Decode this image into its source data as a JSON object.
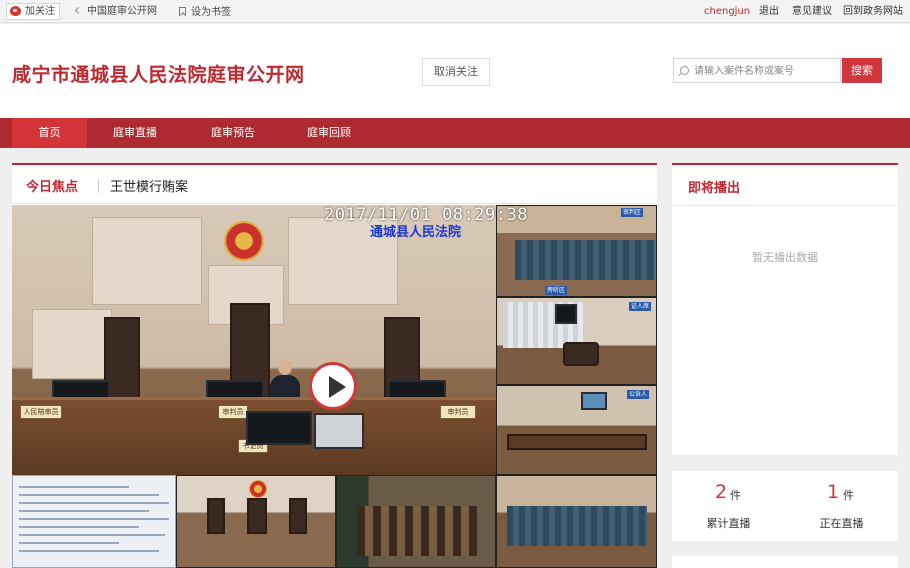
{
  "topbar": {
    "follow_label": "加关注",
    "crumb_label": "中国庭审公开网",
    "bookmark_label": "设为书签",
    "username": "chengjun",
    "logout_label": "退出",
    "feedback_label": "意见建议",
    "gov_label": "回到政务网站"
  },
  "header": {
    "site_title": "咸宁市通城县人民法院庭审公开网",
    "unfollow_label": "取消关注",
    "search_placeholder": "请输入案件名称或案号",
    "search_button": "搜索"
  },
  "nav": {
    "items": [
      "首页",
      "庭审直播",
      "庭审预告",
      "庭审回顾"
    ],
    "active_index": 0
  },
  "focus": {
    "tag": "今日焦点",
    "case_title": "王世模行贿案",
    "video": {
      "timestamp": "2017/11/01 08:29:38",
      "osd_text": "通城县人民法院",
      "plaque_left": "人民陪审员",
      "plaque_mid": "审判员",
      "plaque_right": "审判员",
      "plaque_clerk": "书记员",
      "thumb_label_1": "审判区",
      "thumb_label_2": "旁听区",
      "thumb_label_3": "证人席",
      "thumb_label_4": "公诉人"
    }
  },
  "upcoming": {
    "title": "即将播出",
    "empty_text": "暂无播出数据"
  },
  "stats": [
    {
      "value": "2",
      "unit": "件",
      "label": "累计直播"
    },
    {
      "value": "1",
      "unit": "件",
      "label": "正在直播"
    }
  ],
  "colors": {
    "brand": "#c0282f",
    "nav_bg": "#ad2a31",
    "nav_active": "#d2343a",
    "search_btn": "#d0373d"
  }
}
